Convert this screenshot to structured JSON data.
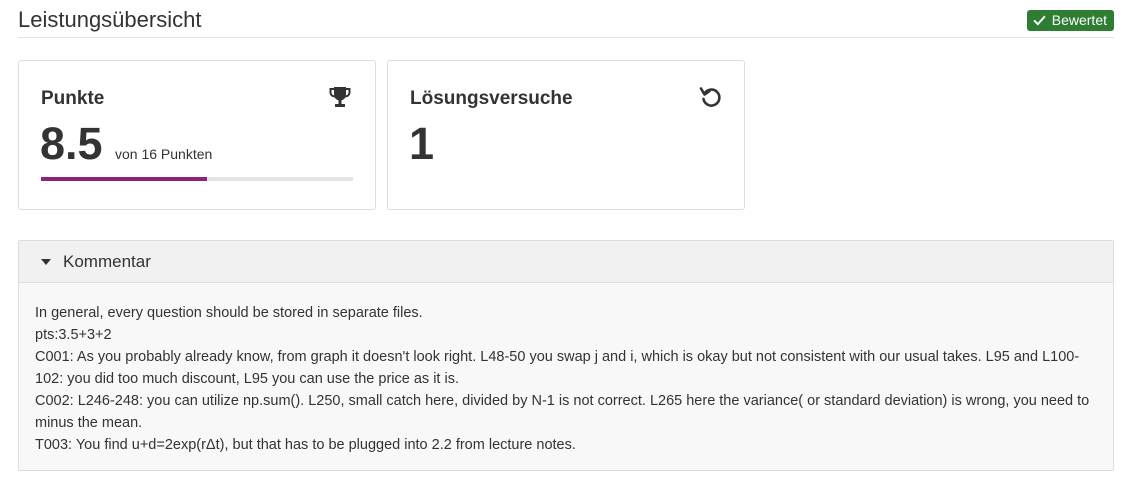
{
  "header": {
    "title": "Leistungsübersicht",
    "status_badge": "Bewertet"
  },
  "points_card": {
    "title": "Punkte",
    "value": "8.5",
    "suffix": "von 16 Punkten",
    "progress_fraction": 0.53125,
    "progress_color": "#8b2381",
    "icon": "trophy-icon"
  },
  "attempts_card": {
    "title": "Lösungsversuche",
    "value": "1",
    "icon": "retry-icon"
  },
  "comment": {
    "title": "Kommentar",
    "lines": [
      "In general, every question should be stored in separate files.",
      "pts:3.5+3+2",
      "C001: As you probably already know, from graph it doesn't look right. L48-50 you swap j and i, which is okay but not consistent with our usual takes. L95 and L100-102: you did too much discount, L95 you can use the price as it is.",
      "C002: L246-248: you can utilize np.sum(). L250, small catch here, divided by N-1 is not correct. L265 here the variance( or standard deviation) is wrong, you need to minus the mean.",
      "T003: You find u+d=2exp(rΔt), but that has to be plugged into 2.2 from lecture notes."
    ]
  }
}
